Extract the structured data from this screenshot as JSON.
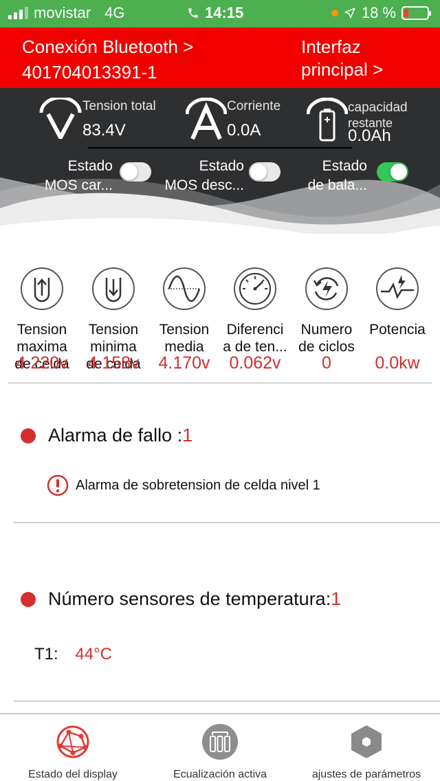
{
  "status_bar": {
    "carrier": "movistar",
    "network": "4G",
    "time": "14:15",
    "battery_percent": "18 %",
    "battery_level": 0.18
  },
  "header": {
    "bluetooth_line1": "Conexión Bluetooth >",
    "bluetooth_line2": "401704013391-1",
    "main_line1": "Interfaz",
    "main_line2": "principal >"
  },
  "metrics": {
    "voltage": {
      "label": "Tension total",
      "value": "83.4V",
      "icon": "voltage-icon"
    },
    "current": {
      "label": "Corriente",
      "value": "0.0A",
      "icon": "current-icon"
    },
    "capacity": {
      "label1": "capacidad",
      "label2": "restante",
      "value": "0.0Ah",
      "icon": "battery-icon"
    }
  },
  "toggles": [
    {
      "line1": "Estado",
      "line2": "MOS car...",
      "on": false
    },
    {
      "line1": "Estado",
      "line2": "MOS desc...",
      "on": false
    },
    {
      "line1": "Estado",
      "line2": "de bala...",
      "on": true
    }
  ],
  "cells": [
    {
      "icon": "arrow-up-icon",
      "label1": "Tension",
      "label2": "maxima",
      "label3": "de celda",
      "value": "4.220v"
    },
    {
      "icon": "arrow-down-icon",
      "label1": "Tension",
      "label2": "minima",
      "label3": "de celda",
      "value": "4.158v"
    },
    {
      "icon": "sine-wave-icon",
      "label1": "Tension",
      "label2": "media",
      "label3": "",
      "value": "4.170v"
    },
    {
      "icon": "gauge-icon",
      "label1": "Diferenci",
      "label2": "a de ten...",
      "label3": "",
      "value": "0.062v"
    },
    {
      "icon": "cycle-icon",
      "label1": "Numero",
      "label2": "de ciclos",
      "label3": "",
      "value": "0"
    },
    {
      "icon": "power-pulse-icon",
      "label1": "",
      "label2": "Potencia",
      "label3": "",
      "value": "0.0kw"
    }
  ],
  "fault": {
    "title": "Alarma de fallo :",
    "count": "1",
    "message": "Alarma de sobretension de celda nivel 1"
  },
  "temperature": {
    "title": "Número sensores de temperatura:",
    "count": "1",
    "sensor_label": "T1:",
    "sensor_value": "44°C"
  },
  "tabs": [
    {
      "label": "Estado del display",
      "icon": "display-status-icon",
      "active": true
    },
    {
      "label": "Ecualización activa",
      "icon": "balance-icon",
      "active": false
    },
    {
      "label": "ajustes de parámetros",
      "icon": "settings-hex-icon",
      "active": false
    }
  ],
  "colors": {
    "header_red": "#f20000",
    "status_green": "#4caf50",
    "value_red": "#d32f2f",
    "panel_dark": "#2e2f31",
    "toggle_on": "#34c759"
  }
}
